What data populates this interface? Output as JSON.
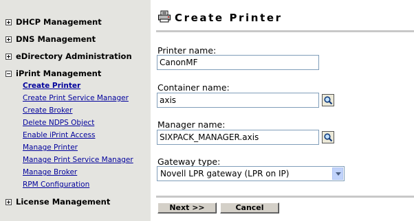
{
  "sidebar": {
    "sections": [
      {
        "label": "DHCP Management",
        "expanded": false
      },
      {
        "label": "DNS Management",
        "expanded": false
      },
      {
        "label": "eDirectory Administration",
        "expanded": false
      },
      {
        "label": "iPrint Management",
        "expanded": true
      },
      {
        "label": "License Management",
        "expanded": false
      }
    ],
    "iprint_links": [
      "Create Printer",
      "Create Print Service Manager",
      "Create Broker",
      "Delete NDPS Object",
      "Enable iPrint Access",
      "Manage Printer",
      "Manage Print Service Manager",
      "Manage Broker",
      "RPM Configuration"
    ],
    "active_link": "Create Printer"
  },
  "main": {
    "title": "Create Printer",
    "title_icon": "printer-icon",
    "fields": {
      "printer_name": {
        "label": "Printer name:",
        "value": "CanonMF"
      },
      "container_name": {
        "label": "Container name:",
        "value": "axis",
        "browse_icon": "search-icon"
      },
      "manager_name": {
        "label": "Manager name:",
        "value": "SIXPACK_MANAGER.axis",
        "browse_icon": "search-icon"
      },
      "gateway_type": {
        "label": "Gateway type:",
        "value": "Novell LPR gateway (LPR on IP)"
      }
    },
    "buttons": {
      "next": "Next >>",
      "cancel": "Cancel"
    }
  },
  "colors": {
    "sidebar_bg": "#e4e4e0",
    "link": "#00009c",
    "rule": "#c8c8c8",
    "input_border": "#7f9db9",
    "button_face": "#d4d0c8"
  }
}
